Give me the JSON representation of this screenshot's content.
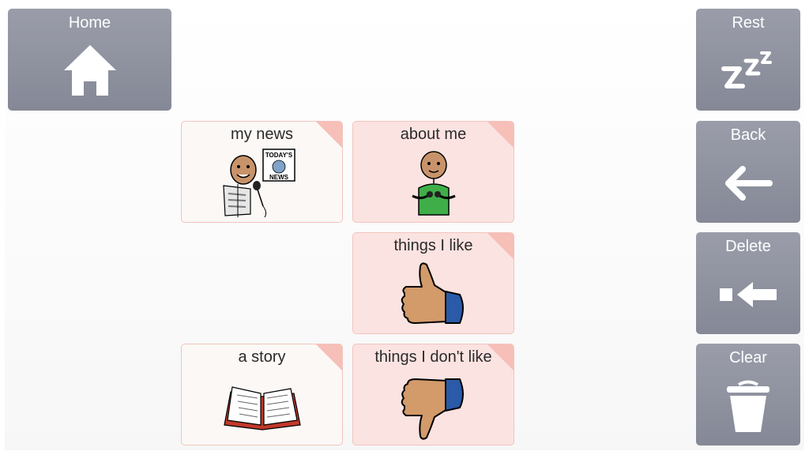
{
  "nav": {
    "home": {
      "label": "Home",
      "icon": "house-icon"
    },
    "rest": {
      "label": "Rest",
      "icon": "sleep-zzz-icon"
    },
    "back": {
      "label": "Back",
      "icon": "arrow-left-icon"
    },
    "delete": {
      "label": "Delete",
      "icon": "delete-backspace-icon"
    },
    "clear": {
      "label": "Clear",
      "icon": "trash-icon"
    }
  },
  "tiles": [
    {
      "label": "my news",
      "icon": "news-reporter-icon"
    },
    {
      "label": "about me",
      "icon": "person-pointing-self-icon"
    },
    {
      "label": "things I like",
      "icon": "thumbs-up-icon"
    },
    {
      "label": "a story",
      "icon": "open-book-icon"
    },
    {
      "label": "things I don't like",
      "icon": "thumbs-down-icon"
    }
  ],
  "news_badge": {
    "line1": "TODAY'S",
    "line2": "NEWS"
  },
  "colors": {
    "nav_button": "#8f929f",
    "tile_pink": "#fbe3e1",
    "tile_white": "#fbf8f5",
    "tile_border": "#f3c4bd",
    "corner_fold": "#f6bfb8"
  }
}
